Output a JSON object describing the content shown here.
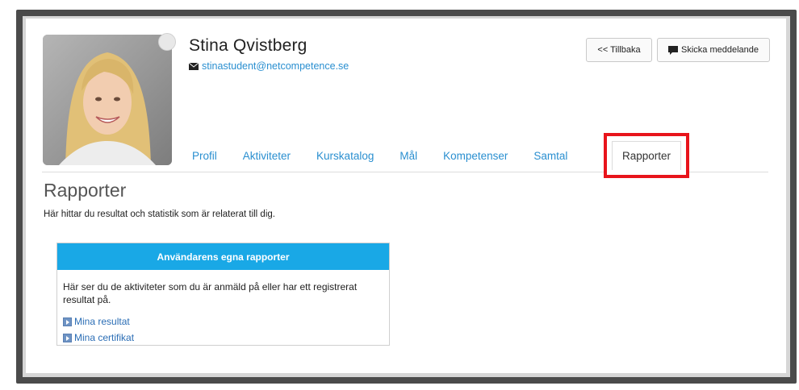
{
  "profile": {
    "name": "Stina Qvistberg",
    "email": "stinastudent@netcompetence.se"
  },
  "header_buttons": {
    "back_label": "<< Tillbaka",
    "message_label": "Skicka meddelande"
  },
  "tabs": [
    {
      "label": "Profil"
    },
    {
      "label": "Aktiviteter"
    },
    {
      "label": "Kurskatalog"
    },
    {
      "label": "Mål"
    },
    {
      "label": "Kompetenser"
    },
    {
      "label": "Samtal"
    }
  ],
  "active_tab": {
    "label": "Rapporter"
  },
  "section": {
    "title": "Rapporter",
    "description": "Här hittar du resultat och statistik som är relaterat till dig."
  },
  "report_card": {
    "title": "Användarens egna rapporter",
    "text": "Här ser du de aktiviteter som du är anmäld på eller har ett registrerat resultat på.",
    "links": [
      {
        "label": "Mina resultat"
      },
      {
        "label": "Mina certifikat"
      }
    ]
  },
  "colors": {
    "accent": "#19a8e6",
    "link": "#2a8fd0",
    "highlight": "#e8141b"
  }
}
